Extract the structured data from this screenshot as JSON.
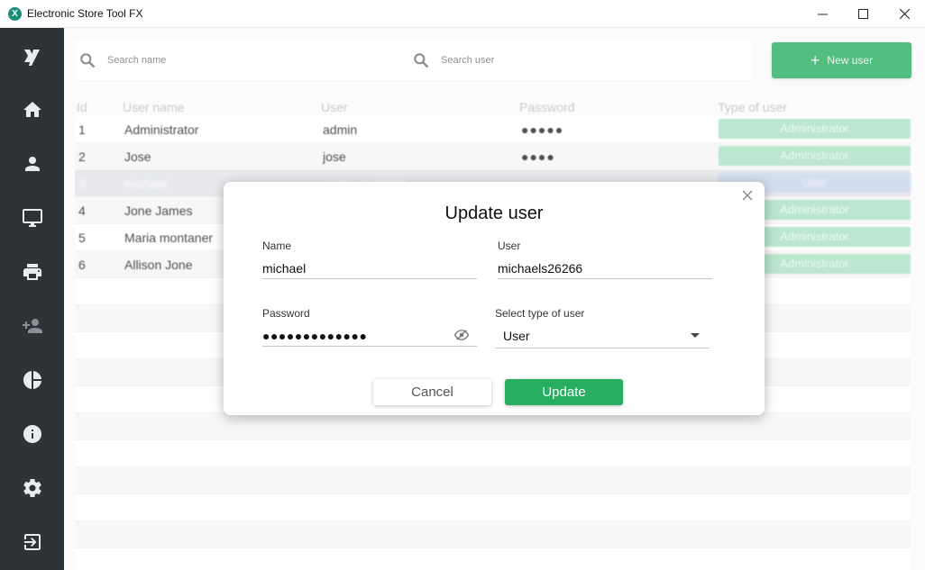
{
  "window": {
    "title": "Electronic Store Tool FX",
    "app_icon_glyph": "X"
  },
  "sidebar": {
    "items": [
      {
        "icon": "logo-icon"
      },
      {
        "icon": "home-icon"
      },
      {
        "icon": "person-icon"
      },
      {
        "icon": "monitor-icon"
      },
      {
        "icon": "printer-icon"
      },
      {
        "icon": "add-user-icon"
      },
      {
        "icon": "pie-chart-icon"
      },
      {
        "icon": "info-icon"
      },
      {
        "icon": "settings-icon"
      },
      {
        "icon": "logout-icon"
      }
    ]
  },
  "search": {
    "name_placeholder": "Search name",
    "user_placeholder": "Search user"
  },
  "new_user_button": {
    "label": "New user",
    "plus": "+"
  },
  "table": {
    "columns": [
      "Id",
      "User name",
      "User",
      "Password",
      "Type of user"
    ],
    "rows": [
      {
        "id": "1",
        "name": "Administrator",
        "user": "admin",
        "password": "●●●●●",
        "type": "Administrator"
      },
      {
        "id": "2",
        "name": "Jose",
        "user": "jose",
        "password": "●●●●",
        "type": "Administrator"
      },
      {
        "id": "3",
        "name": "michael",
        "user": "michaels26266",
        "password": "●●●●●●●●●●●●●",
        "type": "User"
      },
      {
        "id": "4",
        "name": "Jone James",
        "user": "",
        "password": "",
        "type": "Administrator"
      },
      {
        "id": "5",
        "name": "Maria montaner",
        "user": "",
        "password": "",
        "type": "Administrator"
      },
      {
        "id": "6",
        "name": "Allison Jone",
        "user": "",
        "password": "",
        "type": "Administrator"
      }
    ]
  },
  "dialog": {
    "title": "Update user",
    "name_label": "Name",
    "name_value": "michael",
    "user_label": "User",
    "user_value": "michaels26266",
    "password_label": "Password",
    "password_value": "●●●●●●●●●●●●●",
    "type_label": "Select type of user",
    "type_value": "User",
    "cancel_label": "Cancel",
    "update_label": "Update"
  },
  "colors": {
    "accent_green": "#27ae60",
    "sidebar_bg": "#2e3338",
    "badge_admin": "#a9e2c1",
    "badge_user": "#c9d5ec"
  }
}
